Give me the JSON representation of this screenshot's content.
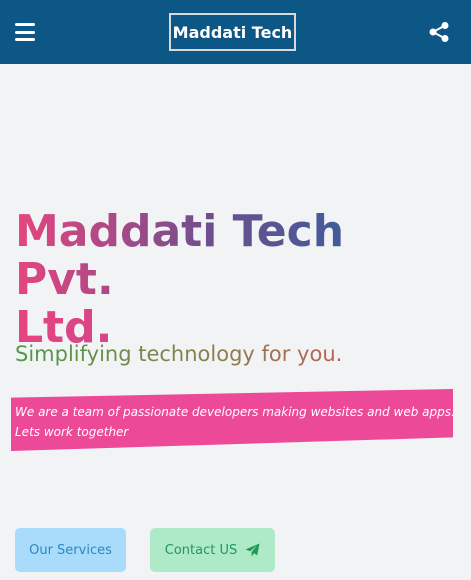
{
  "header": {
    "menu_icon": "hamburger-menu-icon",
    "brand": "Maddati Tech",
    "share_icon": "share-icon",
    "background_color": "#0c5785"
  },
  "hero": {
    "title_line1": "Maddati Tech Pvt.",
    "title_line2": "Ltd.",
    "tagline": "Simplifying technology for you.",
    "banner_line1": "We are a team of passionate developers making websites and web apps.",
    "banner_line2": "Lets work together",
    "banner_color": "#ec4a98"
  },
  "actions": {
    "services_label": "Our Services",
    "contact_label": "Contact US",
    "contact_icon": "paper-plane-icon"
  }
}
